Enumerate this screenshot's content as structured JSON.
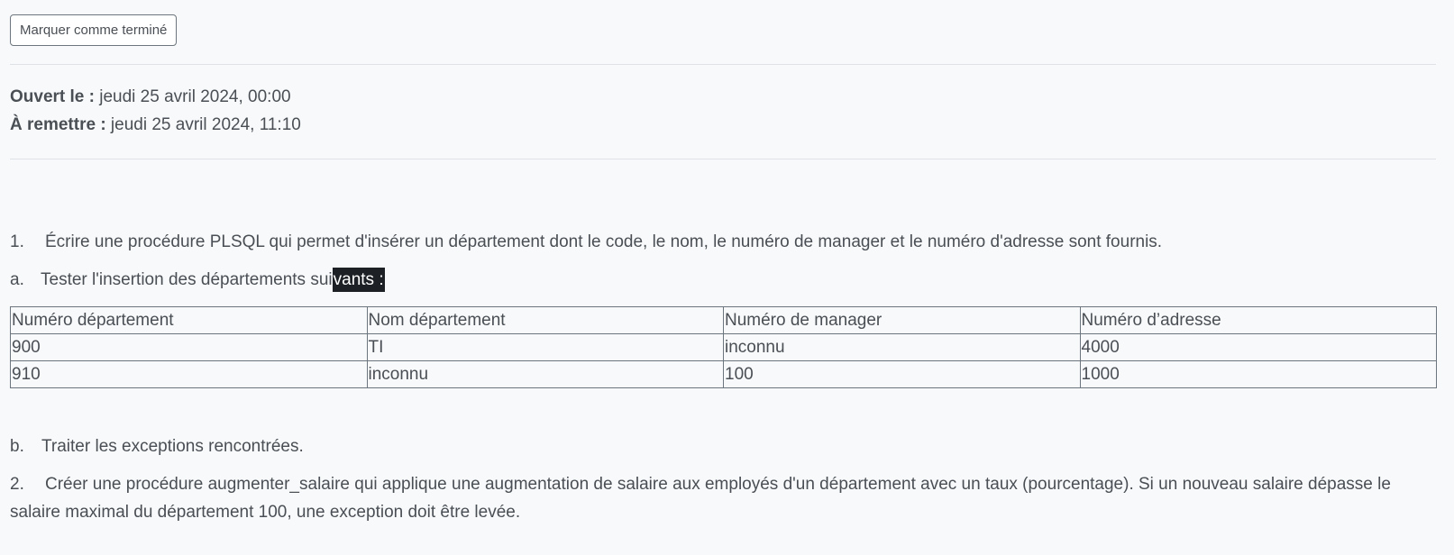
{
  "toolbar": {
    "mark_done_label": "Marquer comme terminé"
  },
  "dates": {
    "opened_label": "Ouvert le :",
    "opened_value": " jeudi 25 avril 2024, 00:00",
    "due_label": "À remettre :",
    "due_value": " jeudi 25 avril 2024, 11:10"
  },
  "content": {
    "q1_number": "1.",
    "q1_text": "Écrire une procédure PLSQL qui permet d'insérer un département dont le code, le nom, le numéro de manager et le numéro d'adresse sont fournis.",
    "qa_number": "a.",
    "qa_text_before": "Tester l'insertion des départements sui",
    "qa_text_selected": "vants :",
    "qb_number": "b.",
    "qb_text": "Traiter les exceptions rencontrées.",
    "q2_number": "2.",
    "q2_text": "Créer une procédure augmenter_salaire qui applique une augmentation de salaire aux employés d'un département avec un taux (pourcentage). Si un nouveau salaire dépasse le salaire maximal du département 100, une exception doit être levée."
  },
  "table": {
    "headers": [
      "Numéro département",
      "Nom département",
      "Numéro de manager",
      "Numéro d’adresse"
    ],
    "rows": [
      [
        "900",
        "TI",
        "inconnu",
        "4000"
      ],
      [
        "910",
        "inconnu",
        "100",
        "1000"
      ]
    ]
  },
  "colors": {
    "background": "#f8f9fa",
    "text": "#4a4f55",
    "selection_bg": "#1d2125",
    "border": "#6c757d"
  }
}
